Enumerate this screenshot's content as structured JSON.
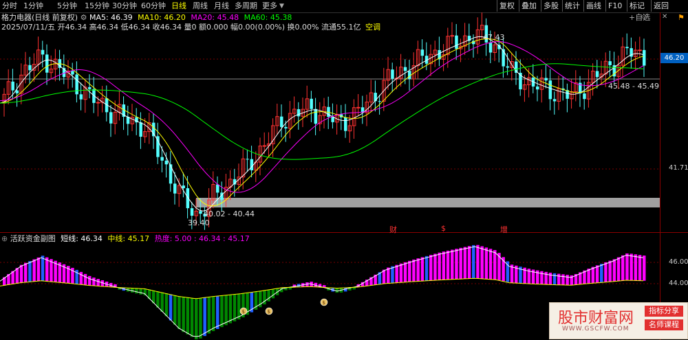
{
  "toolbar": {
    "periods": [
      "分时",
      "1分钟",
      "5分钟",
      "15分钟",
      "30分钟",
      "60分钟",
      "日线",
      "周线",
      "月线",
      "多周期",
      "更多"
    ],
    "active": "日线",
    "right_buttons": [
      "复权",
      "叠加",
      "多股",
      "统计",
      "画线",
      "F10",
      "标记",
      "返回"
    ],
    "add_fav": "+自选"
  },
  "header": {
    "name": "格力电器(日线 前复权)",
    "ma5": "MA5: 46.39",
    "ma10": "MA10: 46.20",
    "ma20": "MA20: 45.48",
    "ma60": "MA60: 45.38",
    "quote": "2025/07/11/五 开46.34 高46.34 低46.34 收46.34 量0 额0.000 幅0.00(0.00%) 换0.00% 流通55.1亿",
    "empty_label": "空调"
  },
  "price_axis": {
    "current": "46.20",
    "low_tick": "41.71"
  },
  "annotations": {
    "high": "47.43",
    "low": "39.40",
    "gap": "40.02 - 40.44",
    "range": "45.48 - 45.49"
  },
  "event_markers": [
    "财",
    "$",
    "增"
  ],
  "indicator": {
    "name": "活跃资金副图",
    "short": "短线: 46.34",
    "mid": "中线: 45.17",
    "heat": "热度: 5.00",
    "extra": ": 46.34 : 45.17",
    "ticks": [
      "46.00",
      "44.00"
    ]
  },
  "watermark": {
    "main": "股市财富网",
    "tag1": "指标分享",
    "tag2": "名师课程",
    "url": "WWW.GSCFW.COM"
  },
  "colors": {
    "up": "#ff3232",
    "down": "#54ffff",
    "ma5": "#ffffff",
    "ma10": "#ffff00",
    "ma20": "#ff00ff",
    "ma60": "#00ff00",
    "band": "#a0a0a0"
  },
  "chart_data": {
    "type": "candlestick",
    "title": "格力电器(日线 前复权)",
    "y_ticks": [
      46.2,
      41.71
    ],
    "highlight_high": 47.43,
    "highlight_low": 39.4,
    "last_close": 46.34,
    "moving_averages": {
      "MA5": 46.39,
      "MA10": 46.2,
      "MA20": 45.48,
      "MA60": 45.38
    },
    "indicator": {
      "short": 46.34,
      "mid": 45.17,
      "heat": 5.0,
      "ticks": [
        46.0,
        44.0
      ]
    }
  }
}
